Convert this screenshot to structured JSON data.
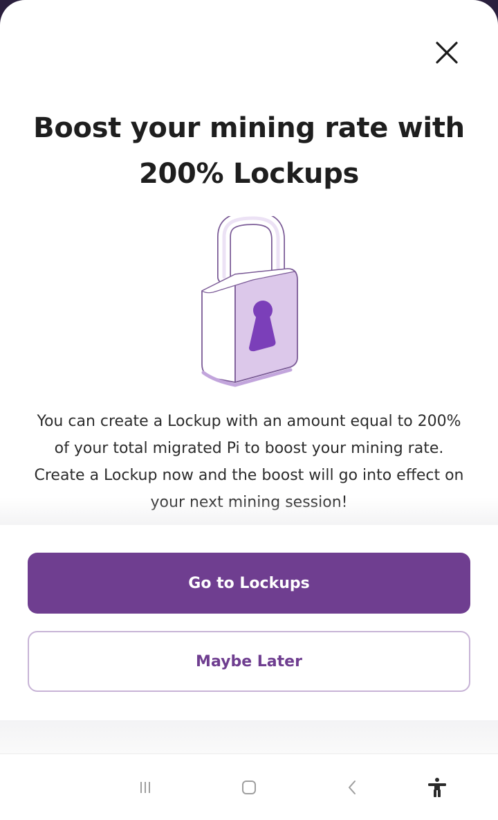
{
  "dialog": {
    "title": "Boost your mining rate with 200% Lockups",
    "description": "You can create a Lockup with an amount equal to 200% of your total migrated Pi to boost your mining rate. Create a Lockup now and the boost will go into effect on your next mining session!",
    "primary_button_label": "Go to Lockups",
    "secondary_button_label": "Maybe Later",
    "close_icon": "close-icon",
    "illustration_icon": "padlock-icon"
  },
  "navigation_bar": {
    "icons": [
      "recent-apps-icon",
      "home-icon",
      "back-icon",
      "accessibility-icon"
    ]
  },
  "colors": {
    "accent": "#6f3e90",
    "secondary_border": "#c7b3d6",
    "lock_body": "#dcc8ea",
    "keyhole": "#7b3fb9",
    "title_text": "#1e1e1e",
    "body_text": "#2b2b2b",
    "backdrop": "#2a1f3d"
  }
}
